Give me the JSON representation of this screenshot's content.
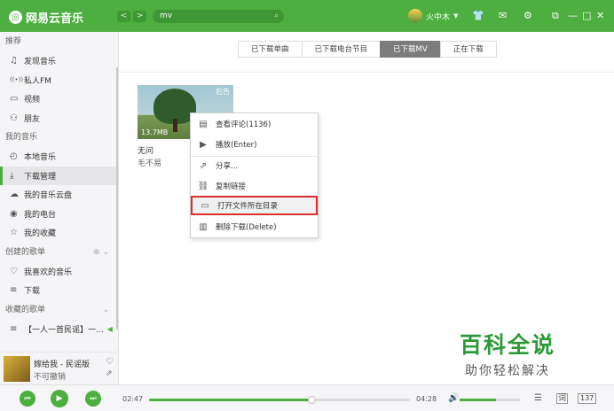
{
  "app": {
    "title": "网易云音乐",
    "search_value": "mv",
    "user_name": "火中木",
    "accent": "#4caf3f"
  },
  "icons": [
    "logo-icon",
    "back-icon",
    "forward-icon",
    "search-icon",
    "skin-icon",
    "mail-icon",
    "settings-icon",
    "minimode-icon",
    "minimize-icon",
    "maximize-icon",
    "close-icon"
  ],
  "sidebar": {
    "recommend_title": "推荐",
    "recommend_items": [
      {
        "label": "发现音乐",
        "icon": "♫"
      },
      {
        "label": "私人FM",
        "icon": "((•))"
      },
      {
        "label": "视频",
        "icon": "▭"
      },
      {
        "label": "朋友",
        "icon": "⚇"
      }
    ],
    "my_music_title": "我的音乐",
    "my_music_items": [
      {
        "label": "本地音乐",
        "icon": "◴"
      },
      {
        "label": "下载管理",
        "icon": "⤓"
      },
      {
        "label": "我的音乐云盘",
        "icon": "☁"
      },
      {
        "label": "我的电台",
        "icon": "◉"
      },
      {
        "label": "我的收藏",
        "icon": "☆"
      }
    ],
    "created_title": "创建的歌单",
    "created_items": [
      {
        "label": "我喜欢的音乐",
        "icon": "♡"
      },
      {
        "label": "下载",
        "icon": "≡"
      }
    ],
    "collected_title": "收藏的歌单",
    "collected_items": [
      {
        "label": "【一人一首民谣】一...",
        "icon": "≡"
      }
    ]
  },
  "now_playing": {
    "title": "嫁给我 - 民谣版",
    "artist": "不可撤销"
  },
  "tabs": [
    "已下载单曲",
    "已下载电台节目",
    "已下载MV",
    "正在下载"
  ],
  "active_tab": 2,
  "mv": {
    "title": "无问",
    "artist": "毛不易",
    "size": "13.7MB",
    "thumb_caption": "后告"
  },
  "context_menu": [
    {
      "label": "查看评论(1136)",
      "icon": "▤"
    },
    {
      "label": "播放(Enter)",
      "icon": "▶"
    },
    {
      "label": "分享...",
      "icon": "⇗"
    },
    {
      "label": "复制链接",
      "icon": "⛓"
    },
    {
      "label": "打开文件所在目录",
      "icon": "▭"
    },
    {
      "label": "删除下载(Delete)",
      "icon": "🗑"
    }
  ],
  "highlighted_menu_index": 4,
  "player": {
    "current_time": "02:47",
    "total_time": "04:28",
    "progress": 0.623,
    "volume": 0.6,
    "lyric_label": "词",
    "playlist_count": "137"
  },
  "watermark": {
    "main": "百科全说",
    "sub": "助你轻松解决"
  }
}
